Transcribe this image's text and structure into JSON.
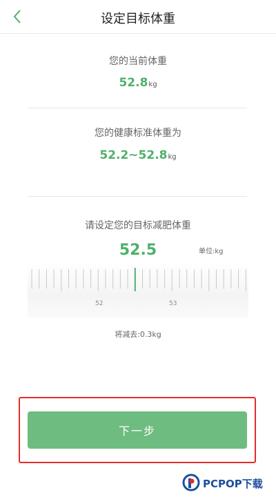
{
  "header": {
    "title": "设定目标体重"
  },
  "current": {
    "label": "您的当前体重",
    "value": "52.8",
    "unit": "kg"
  },
  "standard": {
    "label": "您的健康标准体重为",
    "value": "52.2~52.8",
    "unit": "kg"
  },
  "target": {
    "label": "请设定您的目标减肥体重",
    "value": "52.5",
    "unit_label": "单位:kg",
    "ruler": {
      "min_label": "52",
      "max_label": "53",
      "selected": 52.5
    },
    "remark": "将减去:0.3kg"
  },
  "actions": {
    "next_label": "下一步"
  },
  "watermark": {
    "text": "PCPOP下载"
  },
  "colors": {
    "accent": "#4fb06a",
    "button": "#6ebc7f",
    "highlight": "#e52a2a"
  }
}
